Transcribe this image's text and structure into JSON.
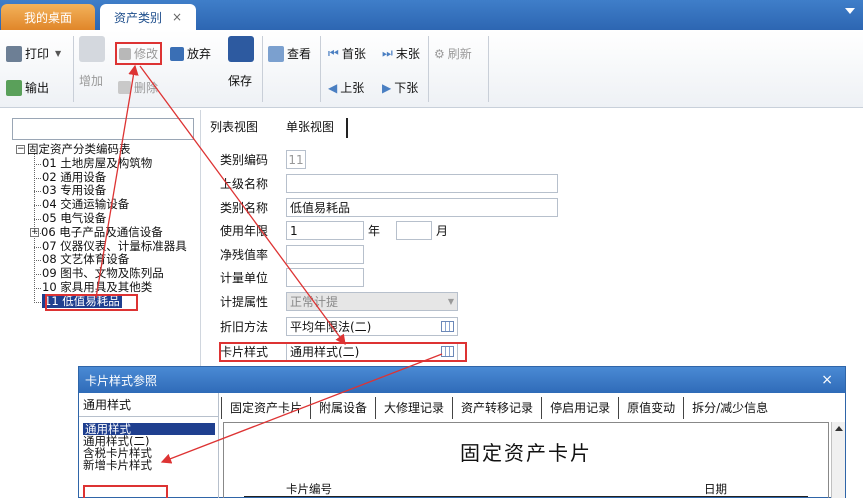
{
  "tabs": [
    {
      "label": "我的桌面"
    },
    {
      "label": "资产类别",
      "close": "×"
    }
  ],
  "ribbon": {
    "print": "打印",
    "export": "输出",
    "add": "增加",
    "edit": "修改",
    "delete": "删除",
    "discard": "放弃",
    "save": "保存",
    "view": "查看",
    "first": "首张",
    "last": "末张",
    "prev": "上张",
    "next": "下张",
    "refresh": "刷新"
  },
  "tree": {
    "root": "固定资产分类编码表",
    "items": [
      "01 土地房屋及构筑物",
      "02 通用设备",
      "03 专用设备",
      "04 交通运输设备",
      "05 电气设备",
      "06 电子产品及通信设备",
      "07 仪器仪表、计量标准器具",
      "08 文艺体育设备",
      "09 图书、文物及陈列品",
      "10 家具用具及其他类",
      "11 低值易耗品"
    ],
    "expander_minus": "−",
    "expander_plus": "+"
  },
  "view_tabs": {
    "list": "列表视图",
    "card": "单张视图"
  },
  "form": {
    "code_label": "类别编码",
    "code_value": "11",
    "parent_label": "上级名称",
    "parent_value": "",
    "name_label": "类别名称",
    "name_value": "低值易耗品",
    "life_label": "使用年限",
    "life_years": "1",
    "life_year_unit": "年",
    "life_months": "",
    "life_month_unit": "月",
    "residual_label": "净残值率",
    "residual_value": "",
    "unit_label": "计量单位",
    "unit_value": "",
    "accrual_label": "计提属性",
    "accrual_value": "正常计提",
    "method_label": "折旧方法",
    "method_value": "平均年限法(二)",
    "card_label": "卡片样式",
    "card_value": "通用样式(二)"
  },
  "dialog": {
    "title": "卡片样式参照",
    "close": "×",
    "left_header": "通用样式",
    "styles": [
      "通用样式",
      "通用样式(二)",
      "含税卡片样式",
      "新增卡片样式"
    ],
    "tabs": [
      "固定资产卡片",
      "附属设备",
      "大修理记录",
      "资产转移记录",
      "停启用记录",
      "原值变动",
      "拆分/减少信息"
    ],
    "preview_title": "固定资产卡片",
    "preview_card_no": "卡片编号",
    "preview_date": "日期"
  },
  "colors": {
    "tabbar": "#2d66b2",
    "home_tab": "#e0862a",
    "selection": "#1f3f8f",
    "annotation": "#dd3333"
  }
}
